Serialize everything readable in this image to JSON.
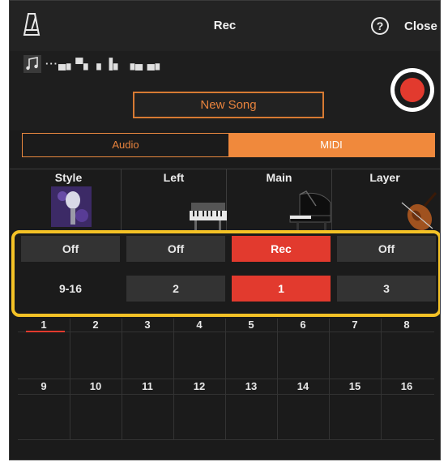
{
  "header": {
    "title": "Rec",
    "help_symbol": "?",
    "close_label": "Close"
  },
  "song": {
    "name": "···▄▖▀▖▗ ▐▖ ▗▄ ▄▖",
    "new_song_label": "New Song"
  },
  "mode_tabs": {
    "audio": "Audio",
    "midi": "MIDI",
    "selected": "MIDI"
  },
  "parts": [
    {
      "label": "Style",
      "icon": "microphone-icon",
      "rec": "Off",
      "channel": "9-16",
      "rec_active": false,
      "channel_active": false
    },
    {
      "label": "Left",
      "icon": "keyboard-icon",
      "rec": "Off",
      "channel": "2",
      "rec_active": false,
      "channel_active": false
    },
    {
      "label": "Main",
      "icon": "piano-icon",
      "rec": "Rec",
      "channel": "1",
      "rec_active": true,
      "channel_active": true
    },
    {
      "label": "Layer",
      "icon": "violin-icon",
      "rec": "Off",
      "channel": "3",
      "rec_active": false,
      "channel_active": false
    }
  ],
  "tracks_row1": [
    "1",
    "2",
    "3",
    "4",
    "5",
    "6",
    "7",
    "8"
  ],
  "tracks_row2": [
    "9",
    "10",
    "11",
    "12",
    "13",
    "14",
    "15",
    "16"
  ],
  "colors": {
    "accent": "#f0893c",
    "record": "#e23a2e",
    "highlight": "#f4c226"
  }
}
